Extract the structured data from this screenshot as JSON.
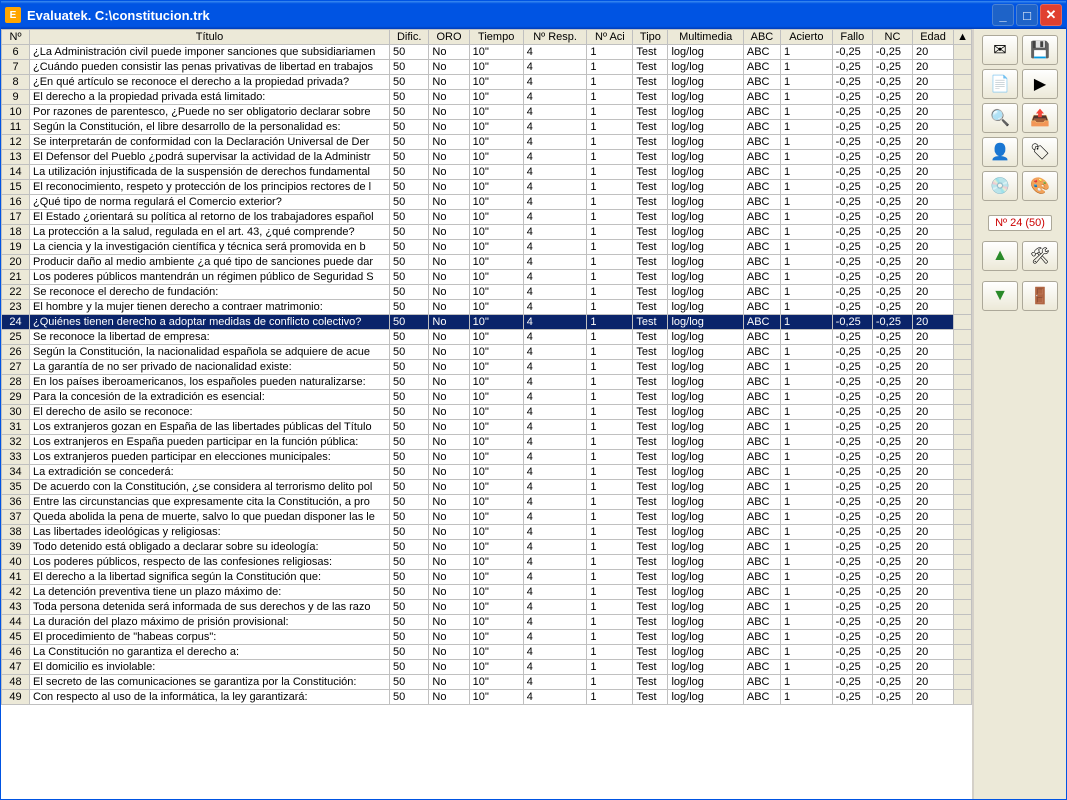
{
  "window": {
    "title": "Evaluatek. C:\\constitucion.trk",
    "app_icon_letter": "E"
  },
  "columns": [
    "Nº",
    "Título",
    "Dific.",
    "ORO",
    "Tiempo",
    "Nº Resp.",
    "Nº Aci",
    "Tipo",
    "Multimedia",
    "ABC",
    "Acierto",
    "Fallo",
    "NC",
    "Edad"
  ],
  "selected_row_index": 18,
  "rows": [
    {
      "n": 6,
      "titulo": "¿La Administración civil puede imponer sanciones que subsidiariamen",
      "dific": "50",
      "oro": "No",
      "tiempo": "10''",
      "nresp": "4",
      "naci": "1",
      "tipo": "Test",
      "multimedia": "log/log",
      "abc": "ABC",
      "acierto": "1",
      "fallo": "-0,25",
      "nc": "-0,25",
      "edad": "20"
    },
    {
      "n": 7,
      "titulo": "¿Cuándo pueden consistir las penas privativas de libertad en trabajos",
      "dific": "50",
      "oro": "No",
      "tiempo": "10''",
      "nresp": "4",
      "naci": "1",
      "tipo": "Test",
      "multimedia": "log/log",
      "abc": "ABC",
      "acierto": "1",
      "fallo": "-0,25",
      "nc": "-0,25",
      "edad": "20"
    },
    {
      "n": 8,
      "titulo": "¿En qué artículo se reconoce el derecho a la propiedad privada?",
      "dific": "50",
      "oro": "No",
      "tiempo": "10''",
      "nresp": "4",
      "naci": "1",
      "tipo": "Test",
      "multimedia": "log/log",
      "abc": "ABC",
      "acierto": "1",
      "fallo": "-0,25",
      "nc": "-0,25",
      "edad": "20"
    },
    {
      "n": 9,
      "titulo": "El derecho a la propiedad privada está limitado:",
      "dific": "50",
      "oro": "No",
      "tiempo": "10''",
      "nresp": "4",
      "naci": "1",
      "tipo": "Test",
      "multimedia": "log/log",
      "abc": "ABC",
      "acierto": "1",
      "fallo": "-0,25",
      "nc": "-0,25",
      "edad": "20"
    },
    {
      "n": 10,
      "titulo": "Por razones de parentesco, ¿Puede no ser obligatorio declarar sobre",
      "dific": "50",
      "oro": "No",
      "tiempo": "10''",
      "nresp": "4",
      "naci": "1",
      "tipo": "Test",
      "multimedia": "log/log",
      "abc": "ABC",
      "acierto": "1",
      "fallo": "-0,25",
      "nc": "-0,25",
      "edad": "20"
    },
    {
      "n": 11,
      "titulo": "Según la Constitución, el libre desarrollo de la personalidad es:",
      "dific": "50",
      "oro": "No",
      "tiempo": "10''",
      "nresp": "4",
      "naci": "1",
      "tipo": "Test",
      "multimedia": "log/log",
      "abc": "ABC",
      "acierto": "1",
      "fallo": "-0,25",
      "nc": "-0,25",
      "edad": "20"
    },
    {
      "n": 12,
      "titulo": "Se interpretarán de conformidad con la Declaración Universal de Der",
      "dific": "50",
      "oro": "No",
      "tiempo": "10''",
      "nresp": "4",
      "naci": "1",
      "tipo": "Test",
      "multimedia": "log/log",
      "abc": "ABC",
      "acierto": "1",
      "fallo": "-0,25",
      "nc": "-0,25",
      "edad": "20"
    },
    {
      "n": 13,
      "titulo": "El Defensor del Pueblo ¿podrá supervisar la actividad de la Administr",
      "dific": "50",
      "oro": "No",
      "tiempo": "10''",
      "nresp": "4",
      "naci": "1",
      "tipo": "Test",
      "multimedia": "log/log",
      "abc": "ABC",
      "acierto": "1",
      "fallo": "-0,25",
      "nc": "-0,25",
      "edad": "20"
    },
    {
      "n": 14,
      "titulo": "La utilización injustificada de la suspensión de derechos fundamental",
      "dific": "50",
      "oro": "No",
      "tiempo": "10''",
      "nresp": "4",
      "naci": "1",
      "tipo": "Test",
      "multimedia": "log/log",
      "abc": "ABC",
      "acierto": "1",
      "fallo": "-0,25",
      "nc": "-0,25",
      "edad": "20"
    },
    {
      "n": 15,
      "titulo": "El reconocimiento, respeto y protección de los principios rectores de l",
      "dific": "50",
      "oro": "No",
      "tiempo": "10''",
      "nresp": "4",
      "naci": "1",
      "tipo": "Test",
      "multimedia": "log/log",
      "abc": "ABC",
      "acierto": "1",
      "fallo": "-0,25",
      "nc": "-0,25",
      "edad": "20"
    },
    {
      "n": 16,
      "titulo": "¿Qué tipo de norma regulará el Comercio exterior?",
      "dific": "50",
      "oro": "No",
      "tiempo": "10''",
      "nresp": "4",
      "naci": "1",
      "tipo": "Test",
      "multimedia": "log/log",
      "abc": "ABC",
      "acierto": "1",
      "fallo": "-0,25",
      "nc": "-0,25",
      "edad": "20"
    },
    {
      "n": 17,
      "titulo": "El Estado ¿orientará su política al retorno de los trabajadores español",
      "dific": "50",
      "oro": "No",
      "tiempo": "10''",
      "nresp": "4",
      "naci": "1",
      "tipo": "Test",
      "multimedia": "log/log",
      "abc": "ABC",
      "acierto": "1",
      "fallo": "-0,25",
      "nc": "-0,25",
      "edad": "20"
    },
    {
      "n": 18,
      "titulo": "La protección a la salud, regulada en el art. 43, ¿qué comprende?",
      "dific": "50",
      "oro": "No",
      "tiempo": "10''",
      "nresp": "4",
      "naci": "1",
      "tipo": "Test",
      "multimedia": "log/log",
      "abc": "ABC",
      "acierto": "1",
      "fallo": "-0,25",
      "nc": "-0,25",
      "edad": "20"
    },
    {
      "n": 19,
      "titulo": "La ciencia y la investigación científica y técnica será promovida en b",
      "dific": "50",
      "oro": "No",
      "tiempo": "10''",
      "nresp": "4",
      "naci": "1",
      "tipo": "Test",
      "multimedia": "log/log",
      "abc": "ABC",
      "acierto": "1",
      "fallo": "-0,25",
      "nc": "-0,25",
      "edad": "20"
    },
    {
      "n": 20,
      "titulo": "Producir daño al medio ambiente ¿a qué tipo de sanciones puede dar",
      "dific": "50",
      "oro": "No",
      "tiempo": "10''",
      "nresp": "4",
      "naci": "1",
      "tipo": "Test",
      "multimedia": "log/log",
      "abc": "ABC",
      "acierto": "1",
      "fallo": "-0,25",
      "nc": "-0,25",
      "edad": "20"
    },
    {
      "n": 21,
      "titulo": "Los poderes públicos mantendrán un régimen público de Seguridad S",
      "dific": "50",
      "oro": "No",
      "tiempo": "10''",
      "nresp": "4",
      "naci": "1",
      "tipo": "Test",
      "multimedia": "log/log",
      "abc": "ABC",
      "acierto": "1",
      "fallo": "-0,25",
      "nc": "-0,25",
      "edad": "20"
    },
    {
      "n": 22,
      "titulo": "Se reconoce el derecho de fundación:",
      "dific": "50",
      "oro": "No",
      "tiempo": "10''",
      "nresp": "4",
      "naci": "1",
      "tipo": "Test",
      "multimedia": "log/log",
      "abc": "ABC",
      "acierto": "1",
      "fallo": "-0,25",
      "nc": "-0,25",
      "edad": "20"
    },
    {
      "n": 23,
      "titulo": "El hombre y la mujer tienen derecho a contraer matrimonio:",
      "dific": "50",
      "oro": "No",
      "tiempo": "10''",
      "nresp": "4",
      "naci": "1",
      "tipo": "Test",
      "multimedia": "log/log",
      "abc": "ABC",
      "acierto": "1",
      "fallo": "-0,25",
      "nc": "-0,25",
      "edad": "20"
    },
    {
      "n": 24,
      "titulo": "¿Quiénes tienen derecho a adoptar medidas de conflicto colectivo?",
      "dific": "50",
      "oro": "No",
      "tiempo": "10''",
      "nresp": "4",
      "naci": "1",
      "tipo": "Test",
      "multimedia": "log/log",
      "abc": "ABC",
      "acierto": "1",
      "fallo": "-0,25",
      "nc": "-0,25",
      "edad": "20"
    },
    {
      "n": 25,
      "titulo": "Se reconoce la libertad de empresa:",
      "dific": "50",
      "oro": "No",
      "tiempo": "10''",
      "nresp": "4",
      "naci": "1",
      "tipo": "Test",
      "multimedia": "log/log",
      "abc": "ABC",
      "acierto": "1",
      "fallo": "-0,25",
      "nc": "-0,25",
      "edad": "20"
    },
    {
      "n": 26,
      "titulo": "Según la Constitución, la nacionalidad española se adquiere de acue",
      "dific": "50",
      "oro": "No",
      "tiempo": "10''",
      "nresp": "4",
      "naci": "1",
      "tipo": "Test",
      "multimedia": "log/log",
      "abc": "ABC",
      "acierto": "1",
      "fallo": "-0,25",
      "nc": "-0,25",
      "edad": "20"
    },
    {
      "n": 27,
      "titulo": "La garantía de no ser privado de nacionalidad existe:",
      "dific": "50",
      "oro": "No",
      "tiempo": "10''",
      "nresp": "4",
      "naci": "1",
      "tipo": "Test",
      "multimedia": "log/log",
      "abc": "ABC",
      "acierto": "1",
      "fallo": "-0,25",
      "nc": "-0,25",
      "edad": "20"
    },
    {
      "n": 28,
      "titulo": "En los países iberoamericanos, los españoles pueden naturalizarse:",
      "dific": "50",
      "oro": "No",
      "tiempo": "10''",
      "nresp": "4",
      "naci": "1",
      "tipo": "Test",
      "multimedia": "log/log",
      "abc": "ABC",
      "acierto": "1",
      "fallo": "-0,25",
      "nc": "-0,25",
      "edad": "20"
    },
    {
      "n": 29,
      "titulo": "Para la concesión de la extradición es esencial:",
      "dific": "50",
      "oro": "No",
      "tiempo": "10''",
      "nresp": "4",
      "naci": "1",
      "tipo": "Test",
      "multimedia": "log/log",
      "abc": "ABC",
      "acierto": "1",
      "fallo": "-0,25",
      "nc": "-0,25",
      "edad": "20"
    },
    {
      "n": 30,
      "titulo": "El derecho de asilo se reconoce:",
      "dific": "50",
      "oro": "No",
      "tiempo": "10''",
      "nresp": "4",
      "naci": "1",
      "tipo": "Test",
      "multimedia": "log/log",
      "abc": "ABC",
      "acierto": "1",
      "fallo": "-0,25",
      "nc": "-0,25",
      "edad": "20"
    },
    {
      "n": 31,
      "titulo": "Los extranjeros gozan en España de las libertades públicas del Título",
      "dific": "50",
      "oro": "No",
      "tiempo": "10''",
      "nresp": "4",
      "naci": "1",
      "tipo": "Test",
      "multimedia": "log/log",
      "abc": "ABC",
      "acierto": "1",
      "fallo": "-0,25",
      "nc": "-0,25",
      "edad": "20"
    },
    {
      "n": 32,
      "titulo": "Los extranjeros en España pueden participar en la función pública:",
      "dific": "50",
      "oro": "No",
      "tiempo": "10''",
      "nresp": "4",
      "naci": "1",
      "tipo": "Test",
      "multimedia": "log/log",
      "abc": "ABC",
      "acierto": "1",
      "fallo": "-0,25",
      "nc": "-0,25",
      "edad": "20"
    },
    {
      "n": 33,
      "titulo": "Los extranjeros pueden participar en elecciones municipales:",
      "dific": "50",
      "oro": "No",
      "tiempo": "10''",
      "nresp": "4",
      "naci": "1",
      "tipo": "Test",
      "multimedia": "log/log",
      "abc": "ABC",
      "acierto": "1",
      "fallo": "-0,25",
      "nc": "-0,25",
      "edad": "20"
    },
    {
      "n": 34,
      "titulo": "La extradición se concederá:",
      "dific": "50",
      "oro": "No",
      "tiempo": "10''",
      "nresp": "4",
      "naci": "1",
      "tipo": "Test",
      "multimedia": "log/log",
      "abc": "ABC",
      "acierto": "1",
      "fallo": "-0,25",
      "nc": "-0,25",
      "edad": "20"
    },
    {
      "n": 35,
      "titulo": "De acuerdo con la Constitución, ¿se considera al terrorismo delito pol",
      "dific": "50",
      "oro": "No",
      "tiempo": "10''",
      "nresp": "4",
      "naci": "1",
      "tipo": "Test",
      "multimedia": "log/log",
      "abc": "ABC",
      "acierto": "1",
      "fallo": "-0,25",
      "nc": "-0,25",
      "edad": "20"
    },
    {
      "n": 36,
      "titulo": "Entre las circunstancias que expresamente cita la Constitución, a pro",
      "dific": "50",
      "oro": "No",
      "tiempo": "10''",
      "nresp": "4",
      "naci": "1",
      "tipo": "Test",
      "multimedia": "log/log",
      "abc": "ABC",
      "acierto": "1",
      "fallo": "-0,25",
      "nc": "-0,25",
      "edad": "20"
    },
    {
      "n": 37,
      "titulo": "Queda abolida la pena de muerte, salvo lo que puedan disponer las le",
      "dific": "50",
      "oro": "No",
      "tiempo": "10''",
      "nresp": "4",
      "naci": "1",
      "tipo": "Test",
      "multimedia": "log/log",
      "abc": "ABC",
      "acierto": "1",
      "fallo": "-0,25",
      "nc": "-0,25",
      "edad": "20"
    },
    {
      "n": 38,
      "titulo": "Las libertades ideológicas y religiosas:",
      "dific": "50",
      "oro": "No",
      "tiempo": "10''",
      "nresp": "4",
      "naci": "1",
      "tipo": "Test",
      "multimedia": "log/log",
      "abc": "ABC",
      "acierto": "1",
      "fallo": "-0,25",
      "nc": "-0,25",
      "edad": "20"
    },
    {
      "n": 39,
      "titulo": "Todo detenido está obligado a declarar sobre su ideología:",
      "dific": "50",
      "oro": "No",
      "tiempo": "10''",
      "nresp": "4",
      "naci": "1",
      "tipo": "Test",
      "multimedia": "log/log",
      "abc": "ABC",
      "acierto": "1",
      "fallo": "-0,25",
      "nc": "-0,25",
      "edad": "20"
    },
    {
      "n": 40,
      "titulo": "Los poderes públicos, respecto de las confesiones religiosas:",
      "dific": "50",
      "oro": "No",
      "tiempo": "10''",
      "nresp": "4",
      "naci": "1",
      "tipo": "Test",
      "multimedia": "log/log",
      "abc": "ABC",
      "acierto": "1",
      "fallo": "-0,25",
      "nc": "-0,25",
      "edad": "20"
    },
    {
      "n": 41,
      "titulo": "El derecho a la libertad significa según la Constitución que:",
      "dific": "50",
      "oro": "No",
      "tiempo": "10''",
      "nresp": "4",
      "naci": "1",
      "tipo": "Test",
      "multimedia": "log/log",
      "abc": "ABC",
      "acierto": "1",
      "fallo": "-0,25",
      "nc": "-0,25",
      "edad": "20"
    },
    {
      "n": 42,
      "titulo": "La detención preventiva tiene un plazo máximo de:",
      "dific": "50",
      "oro": "No",
      "tiempo": "10''",
      "nresp": "4",
      "naci": "1",
      "tipo": "Test",
      "multimedia": "log/log",
      "abc": "ABC",
      "acierto": "1",
      "fallo": "-0,25",
      "nc": "-0,25",
      "edad": "20"
    },
    {
      "n": 43,
      "titulo": "Toda persona detenida será informada de sus derechos y de las razo",
      "dific": "50",
      "oro": "No",
      "tiempo": "10''",
      "nresp": "4",
      "naci": "1",
      "tipo": "Test",
      "multimedia": "log/log",
      "abc": "ABC",
      "acierto": "1",
      "fallo": "-0,25",
      "nc": "-0,25",
      "edad": "20"
    },
    {
      "n": 44,
      "titulo": "La duración del plazo máximo de prisión provisional:",
      "dific": "50",
      "oro": "No",
      "tiempo": "10''",
      "nresp": "4",
      "naci": "1",
      "tipo": "Test",
      "multimedia": "log/log",
      "abc": "ABC",
      "acierto": "1",
      "fallo": "-0,25",
      "nc": "-0,25",
      "edad": "20"
    },
    {
      "n": 45,
      "titulo": "El procedimiento de \"habeas corpus\":",
      "dific": "50",
      "oro": "No",
      "tiempo": "10''",
      "nresp": "4",
      "naci": "1",
      "tipo": "Test",
      "multimedia": "log/log",
      "abc": "ABC",
      "acierto": "1",
      "fallo": "-0,25",
      "nc": "-0,25",
      "edad": "20"
    },
    {
      "n": 46,
      "titulo": "La Constitución no garantiza el derecho a:",
      "dific": "50",
      "oro": "No",
      "tiempo": "10''",
      "nresp": "4",
      "naci": "1",
      "tipo": "Test",
      "multimedia": "log/log",
      "abc": "ABC",
      "acierto": "1",
      "fallo": "-0,25",
      "nc": "-0,25",
      "edad": "20"
    },
    {
      "n": 47,
      "titulo": "El domicilio es inviolable:",
      "dific": "50",
      "oro": "No",
      "tiempo": "10''",
      "nresp": "4",
      "naci": "1",
      "tipo": "Test",
      "multimedia": "log/log",
      "abc": "ABC",
      "acierto": "1",
      "fallo": "-0,25",
      "nc": "-0,25",
      "edad": "20"
    },
    {
      "n": 48,
      "titulo": "El secreto de las comunicaciones se garantiza por la Constitución:",
      "dific": "50",
      "oro": "No",
      "tiempo": "10''",
      "nresp": "4",
      "naci": "1",
      "tipo": "Test",
      "multimedia": "log/log",
      "abc": "ABC",
      "acierto": "1",
      "fallo": "-0,25",
      "nc": "-0,25",
      "edad": "20"
    },
    {
      "n": 49,
      "titulo": "Con respecto al uso de la informática, la ley garantizará:",
      "dific": "50",
      "oro": "No",
      "tiempo": "10''",
      "nresp": "4",
      "naci": "1",
      "tipo": "Test",
      "multimedia": "log/log",
      "abc": "ABC",
      "acierto": "1",
      "fallo": "-0,25",
      "nc": "-0,25",
      "edad": "20"
    }
  ],
  "sidebar": {
    "status": "Nº 24 (50)",
    "buttons": [
      {
        "name": "mail-button",
        "icon": "✉"
      },
      {
        "name": "save-button",
        "icon": "💾"
      },
      {
        "name": "new-button",
        "icon": "📄"
      },
      {
        "name": "edit-play-button",
        "icon": "▶"
      },
      {
        "name": "preview-button",
        "icon": "🔍"
      },
      {
        "name": "export-button",
        "icon": "📤"
      },
      {
        "name": "user-button",
        "icon": "👤"
      },
      {
        "name": "tag-button",
        "icon": "🏷"
      },
      {
        "name": "disc-button",
        "icon": "💿"
      },
      {
        "name": "paint-button",
        "icon": "🎨"
      }
    ],
    "up_icon": "▲",
    "down_icon": "▼",
    "config_icon": "🛠",
    "exit_icon": "🚪"
  }
}
